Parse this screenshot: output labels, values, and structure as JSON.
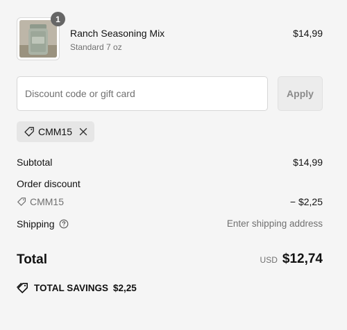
{
  "product": {
    "name": "Ranch Seasoning Mix",
    "variant": "Standard 7 oz",
    "price": "$14,99",
    "quantity": "1"
  },
  "discount": {
    "placeholder": "Discount code or gift card",
    "value": "",
    "apply_label": "Apply",
    "applied_code": "CMM15"
  },
  "summary": {
    "subtotal_label": "Subtotal",
    "subtotal_value": "$14,99",
    "order_discount_label": "Order discount",
    "discount_code": "CMM15",
    "discount_value": "− $2,25",
    "shipping_label": "Shipping",
    "shipping_value": "Enter shipping address",
    "total_label": "Total",
    "currency": "USD",
    "total_value": "$12,74",
    "savings_label": "TOTAL SAVINGS",
    "savings_value": "$2,25"
  },
  "icons": {
    "tag": "tag-icon",
    "remove": "close-icon",
    "help": "question-circle-icon",
    "savings": "tag-icon"
  },
  "colors": {
    "background": "#f5f5f5",
    "muted_text": "#707070",
    "badge": "#666666",
    "chip_bg": "#e6e6e6"
  }
}
